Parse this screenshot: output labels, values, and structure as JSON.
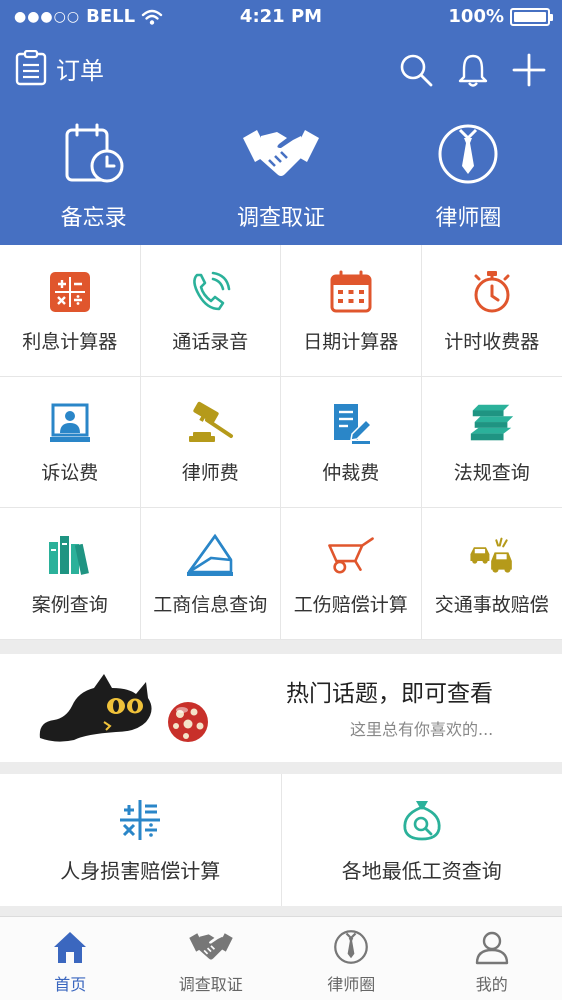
{
  "status_bar": {
    "carrier": "BELL",
    "signal_dots": "●●●○○",
    "time": "4:21 PM",
    "battery": "100%",
    "battery_level": 1.0
  },
  "navbar": {
    "title": "订单",
    "icons": [
      "clipboard-icon",
      "search-icon",
      "bell-icon",
      "plus-icon"
    ]
  },
  "hero": [
    {
      "label": "备忘录",
      "icon": "memo-clock-icon"
    },
    {
      "label": "调查取证",
      "icon": "handshake-icon"
    },
    {
      "label": "律师圈",
      "icon": "lawyer-tie-icon"
    }
  ],
  "tools": [
    {
      "label": "利息计算器",
      "icon": "calculator-icon",
      "color": "#e0562d"
    },
    {
      "label": "通话录音",
      "icon": "phone-icon",
      "color": "#2bb19a"
    },
    {
      "label": "日期计算器",
      "icon": "calendar-icon",
      "color": "#e0562d"
    },
    {
      "label": "计时收费器",
      "icon": "stopwatch-icon",
      "color": "#e0562d"
    },
    {
      "label": "诉讼费",
      "icon": "court-icon",
      "color": "#2a86c8"
    },
    {
      "label": "律师费",
      "icon": "gavel-icon",
      "color": "#b59a1a"
    },
    {
      "label": "仲裁费",
      "icon": "document-pen-icon",
      "color": "#2a86c8"
    },
    {
      "label": "法规查询",
      "icon": "books-stack-icon",
      "color": "#2bb19a"
    },
    {
      "label": "案例查询",
      "icon": "books-upright-icon",
      "color": "#2bb19a"
    },
    {
      "label": "工商信息查询",
      "icon": "envelope-icon",
      "color": "#2a86c8"
    },
    {
      "label": "工伤赔偿计算",
      "icon": "wheelbarrow-icon",
      "color": "#e0562d"
    },
    {
      "label": "交通事故赔偿",
      "icon": "car-crash-icon",
      "color": "#b59a1a"
    }
  ],
  "banner": {
    "title": "热门话题，即可查看",
    "subtitle": "这里总有你喜欢的..."
  },
  "cards": [
    {
      "label": "人身损害赔偿计算",
      "icon": "math-grid-icon",
      "color": "#2a86c8"
    },
    {
      "label": "各地最低工资查询",
      "icon": "money-bag-search-icon",
      "color": "#2bb19a"
    }
  ],
  "tabbar": [
    {
      "label": "首页",
      "icon": "home-icon",
      "active": true
    },
    {
      "label": "调查取证",
      "icon": "handshake-icon",
      "active": false
    },
    {
      "label": "律师圈",
      "icon": "lawyer-tie-icon",
      "active": false
    },
    {
      "label": "我的",
      "icon": "user-icon",
      "active": false
    }
  ],
  "colors": {
    "header_bg": "#4670c2",
    "tab_active": "#3b67bf",
    "accent_orange": "#e0562d",
    "accent_teal": "#2bb19a",
    "accent_blue": "#2a86c8",
    "accent_gold": "#b59a1a"
  }
}
